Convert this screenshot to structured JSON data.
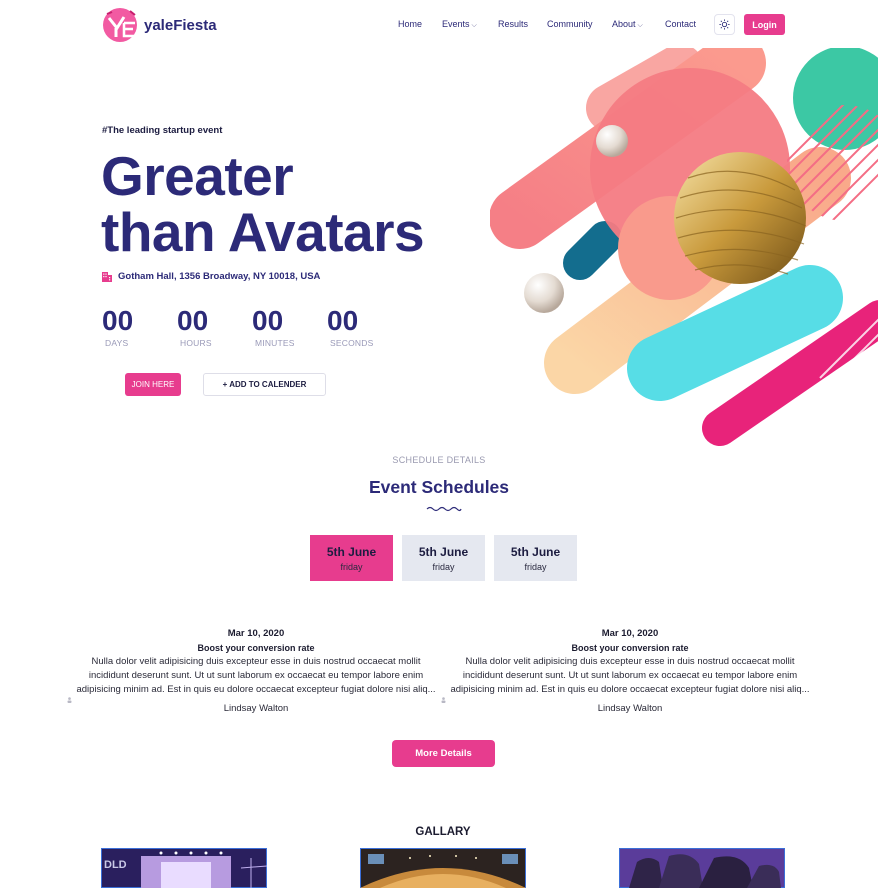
{
  "brand": {
    "name": "yaleFiesta",
    "colors": {
      "primary": "#2c2a78",
      "accent": "#e73c8e"
    }
  },
  "nav": {
    "items": [
      {
        "label": "Home",
        "has_dropdown": false
      },
      {
        "label": "Events",
        "has_dropdown": true
      },
      {
        "label": "Results",
        "has_dropdown": false
      },
      {
        "label": "Community",
        "has_dropdown": false
      },
      {
        "label": "About",
        "has_dropdown": true
      },
      {
        "label": "Contact",
        "has_dropdown": false
      }
    ],
    "theme_icon": "sun-icon",
    "login_label": "Login"
  },
  "hero": {
    "tagline": "#The leading startup event",
    "title_line1": "Greater",
    "title_line2": "than Avatars",
    "venue": "Gotham Hall, 1356 Broadway, NY 10018, USA",
    "countdown": [
      {
        "value": "00",
        "label": "DAYS"
      },
      {
        "value": "00",
        "label": "HOURS"
      },
      {
        "value": "00",
        "label": "MINUTES"
      },
      {
        "value": "00",
        "label": "SECONDS"
      }
    ],
    "join_label": "JOIN HERE",
    "calendar_label": "+ ADD TO CALENDER"
  },
  "schedule": {
    "subtitle": "SCHEDULE DETAILS",
    "title": "Event Schedules",
    "tabs": [
      {
        "date": "5th June",
        "weekday": "friday",
        "active": true
      },
      {
        "date": "5th June",
        "weekday": "friday",
        "active": false
      },
      {
        "date": "5th June",
        "weekday": "friday",
        "active": false
      }
    ],
    "events": [
      {
        "date": "Mar 10, 2020",
        "title": "Boost your conversion rate",
        "desc_line1": "Nulla dolor velit adipisicing duis excepteur esse in duis nostrud occaecat mollit",
        "desc_line2": "incididunt deserunt sunt. Ut ut sunt laborum ex occaecat eu tempor labore enim",
        "desc_line3": "adipisicing minim ad. Est in quis eu dolore occaecat excepteur fugiat dolore nisi aliq...",
        "speaker": "Lindsay Walton"
      },
      {
        "date": "Mar 10, 2020",
        "title": "Boost your conversion rate",
        "desc_line1": "Nulla dolor velit adipisicing duis excepteur esse in duis nostrud occaecat mollit",
        "desc_line2": "incididunt deserunt sunt. Ut ut sunt laborum ex occaecat eu tempor labore enim",
        "desc_line3": "adipisicing minim ad. Est in quis eu dolore occaecat excepteur fugiat dolore nisi aliq...",
        "speaker": "Lindsay Walton"
      }
    ],
    "more_label": "More Details"
  },
  "gallery": {
    "title": "GALLARY",
    "images": [
      "conference-stage-image",
      "auditorium-image",
      "concert-hall-building-image"
    ],
    "stage_sign": "DLD"
  }
}
